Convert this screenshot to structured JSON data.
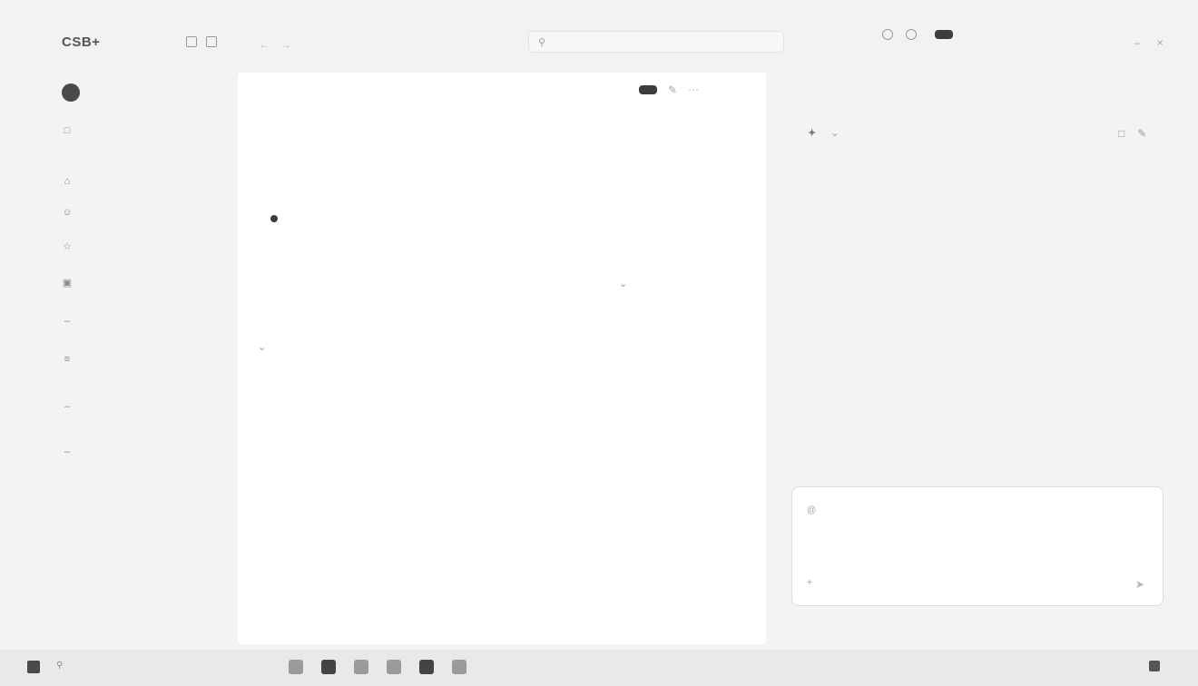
{
  "app": {
    "logo": "CSB+"
  },
  "topbar": {
    "search": {
      "placeholder": "",
      "shortcut": ""
    },
    "share_label": "",
    "primary_label": ""
  },
  "sidebar": {
    "user_name": "",
    "user_sub": "",
    "items": [
      {
        "label": ""
      },
      {
        "label": ""
      },
      {
        "label": ""
      },
      {
        "label": ""
      },
      {
        "label": ""
      },
      {
        "label": ""
      },
      {
        "label": ""
      },
      {
        "label": ""
      },
      {
        "label": ""
      }
    ],
    "footer": [
      "",
      ""
    ]
  },
  "main": {
    "breadcrumb": "",
    "action_label": "",
    "page_title": "",
    "meta": {
      "owner": "",
      "field_1": "",
      "field_2": "",
      "field_3": ""
    },
    "tabs": [
      {
        "label": ""
      },
      {
        "label": ""
      }
    ],
    "sort_label": "",
    "section_title": "",
    "body_lines": [
      "",
      "",
      "",
      "",
      "",
      "",
      "",
      "",
      "",
      ""
    ],
    "bottom_actions": [
      "",
      "",
      ""
    ]
  },
  "panel": {
    "tabs": [
      {
        "label": ""
      },
      {
        "label": ""
      }
    ],
    "model_label": "",
    "suggestions": [
      "",
      "",
      ""
    ],
    "composer": {
      "placeholder": "",
      "sub": "",
      "mode_label": ""
    }
  },
  "taskbar": {
    "search_label": "",
    "tray": [
      "",
      ""
    ],
    "clock": [
      "",
      ""
    ]
  }
}
